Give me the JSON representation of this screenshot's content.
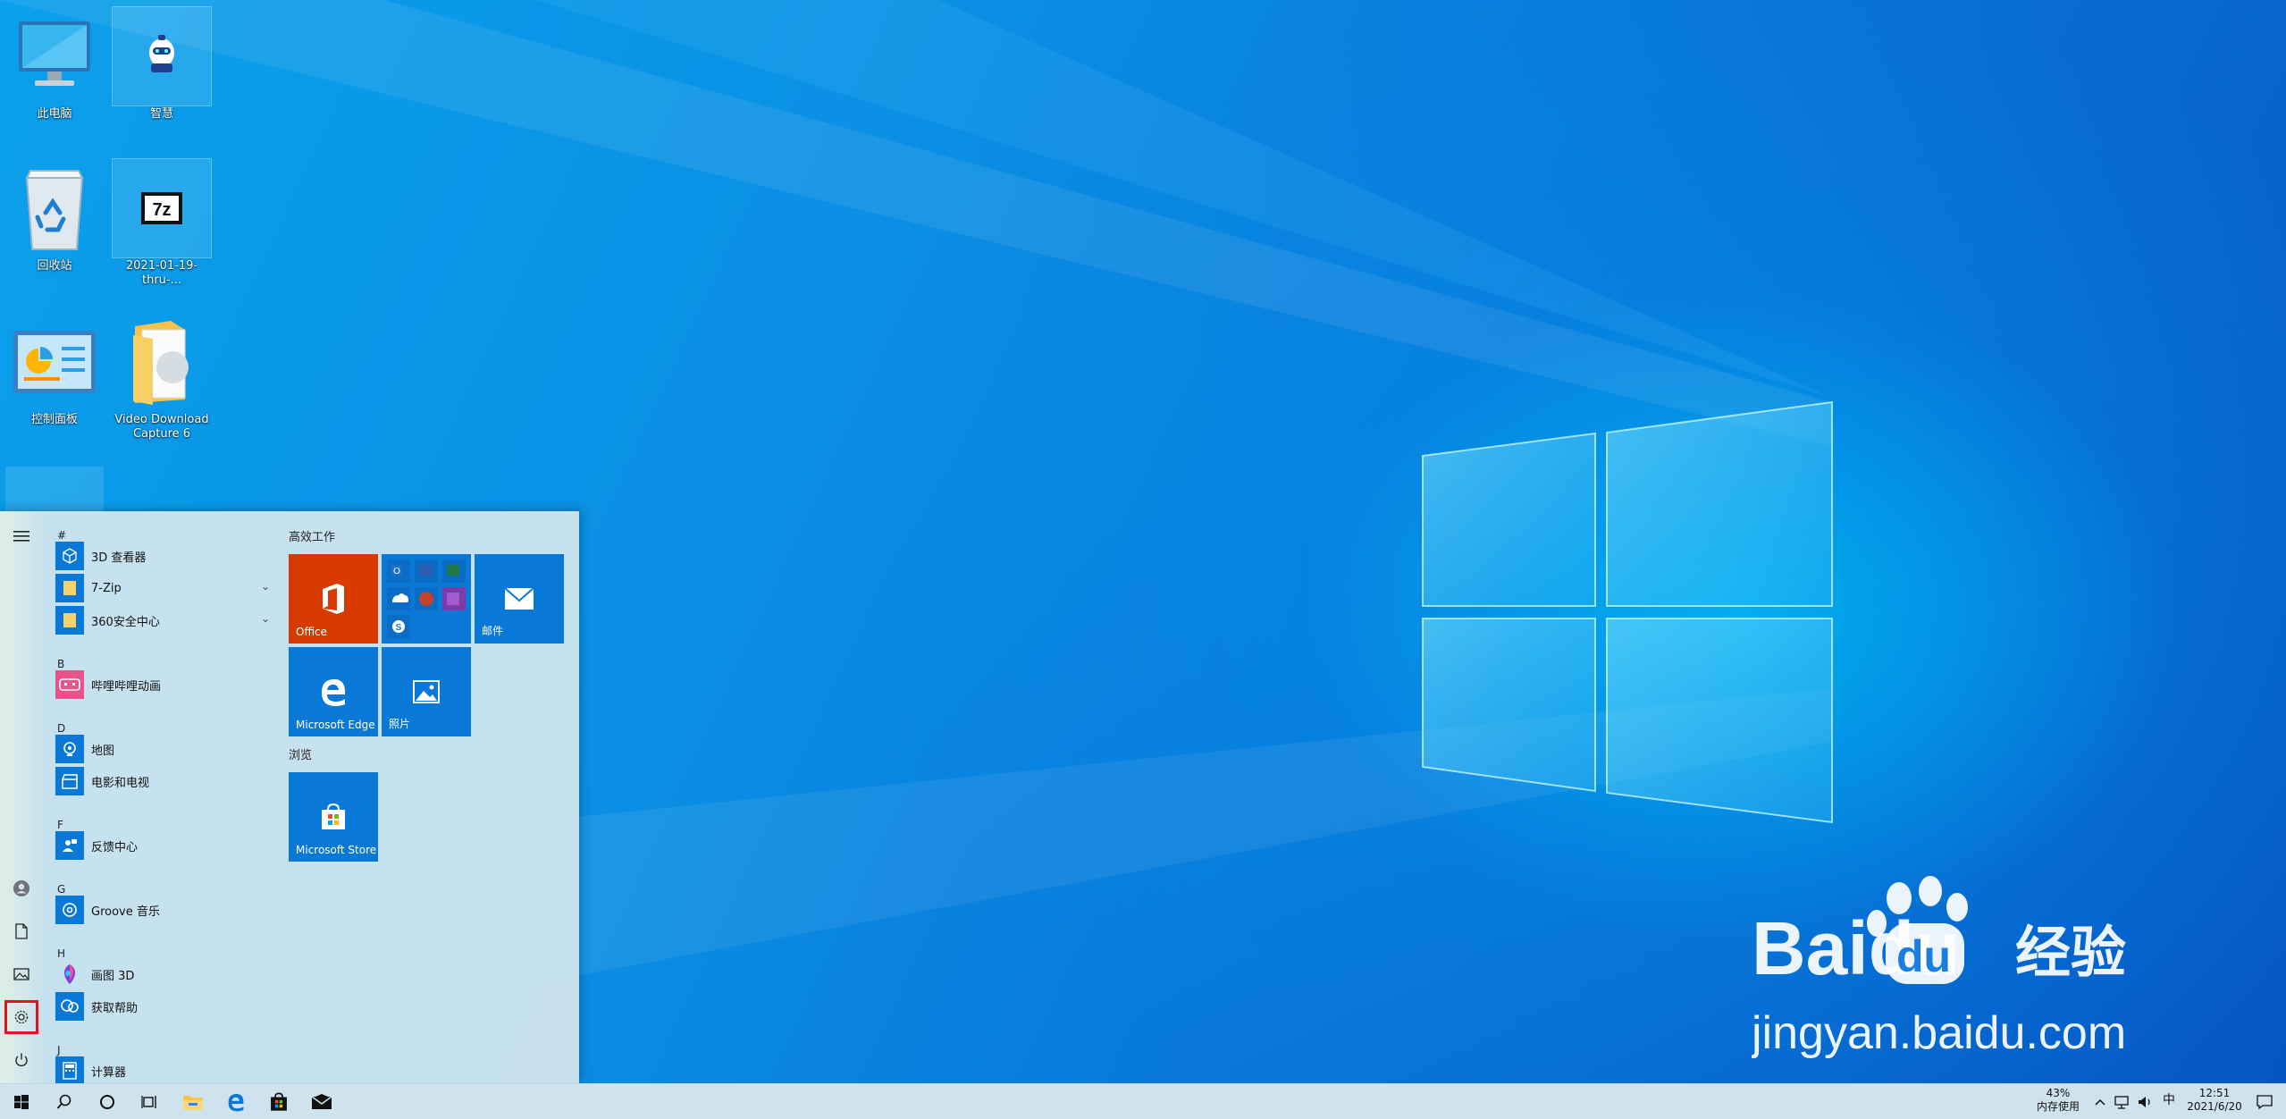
{
  "desktop": {
    "icons": [
      {
        "label": "此电脑",
        "icon": "computer-icon"
      },
      {
        "label": "智慧",
        "icon": "robot-icon"
      },
      {
        "label": "回收站",
        "icon": "recycle-bin-icon"
      },
      {
        "label": "2021-01-19-thru-...",
        "icon": "7zip-archive-icon"
      },
      {
        "label": "控制面板",
        "icon": "control-panel-icon"
      },
      {
        "label": "Video Download Capture 6",
        "icon": "folder-icon"
      }
    ]
  },
  "start_menu": {
    "app_list": [
      {
        "type": "letter",
        "text": "#"
      },
      {
        "type": "app",
        "name": "3D 查看器",
        "icon": "3d-viewer-icon"
      },
      {
        "type": "app",
        "name": "7-Zip",
        "icon": "folder-icon",
        "expandable": true
      },
      {
        "type": "app",
        "name": "360安全中心",
        "icon": "folder-icon",
        "expandable": true
      },
      {
        "type": "letter",
        "text": "B"
      },
      {
        "type": "app",
        "name": "哔哩哔哩动画",
        "icon": "bilibili-icon"
      },
      {
        "type": "letter",
        "text": "D"
      },
      {
        "type": "app",
        "name": "地图",
        "icon": "maps-icon"
      },
      {
        "type": "app",
        "name": "电影和电视",
        "icon": "movies-tv-icon"
      },
      {
        "type": "letter",
        "text": "F"
      },
      {
        "type": "app",
        "name": "反馈中心",
        "icon": "feedback-hub-icon"
      },
      {
        "type": "letter",
        "text": "G"
      },
      {
        "type": "app",
        "name": "Groove 音乐",
        "icon": "groove-music-icon"
      },
      {
        "type": "letter",
        "text": "H"
      },
      {
        "type": "app",
        "name": "画图 3D",
        "icon": "paint-3d-icon"
      },
      {
        "type": "app",
        "name": "获取帮助",
        "icon": "get-help-icon"
      },
      {
        "type": "letter",
        "text": "J"
      },
      {
        "type": "app",
        "name": "计算器",
        "icon": "calculator-icon"
      }
    ],
    "groups": [
      {
        "title": "高效工作"
      },
      {
        "title": "浏览"
      }
    ],
    "tiles": {
      "office": "Office",
      "mail": "邮件",
      "edge": "Microsoft Edge",
      "photos": "照片",
      "store": "Microsoft Store"
    },
    "colors": {
      "office": "#d83b01",
      "accent_tile": "#0a78d7"
    }
  },
  "taskbar": {
    "memory_percent": "43%",
    "memory_label": "内存使用",
    "ime": "中",
    "time": "12:51",
    "date": "2021/6/20"
  },
  "watermark": {
    "brand": "Baidu",
    "brand_cn": "经验",
    "url": "jingyan.baidu.com"
  }
}
